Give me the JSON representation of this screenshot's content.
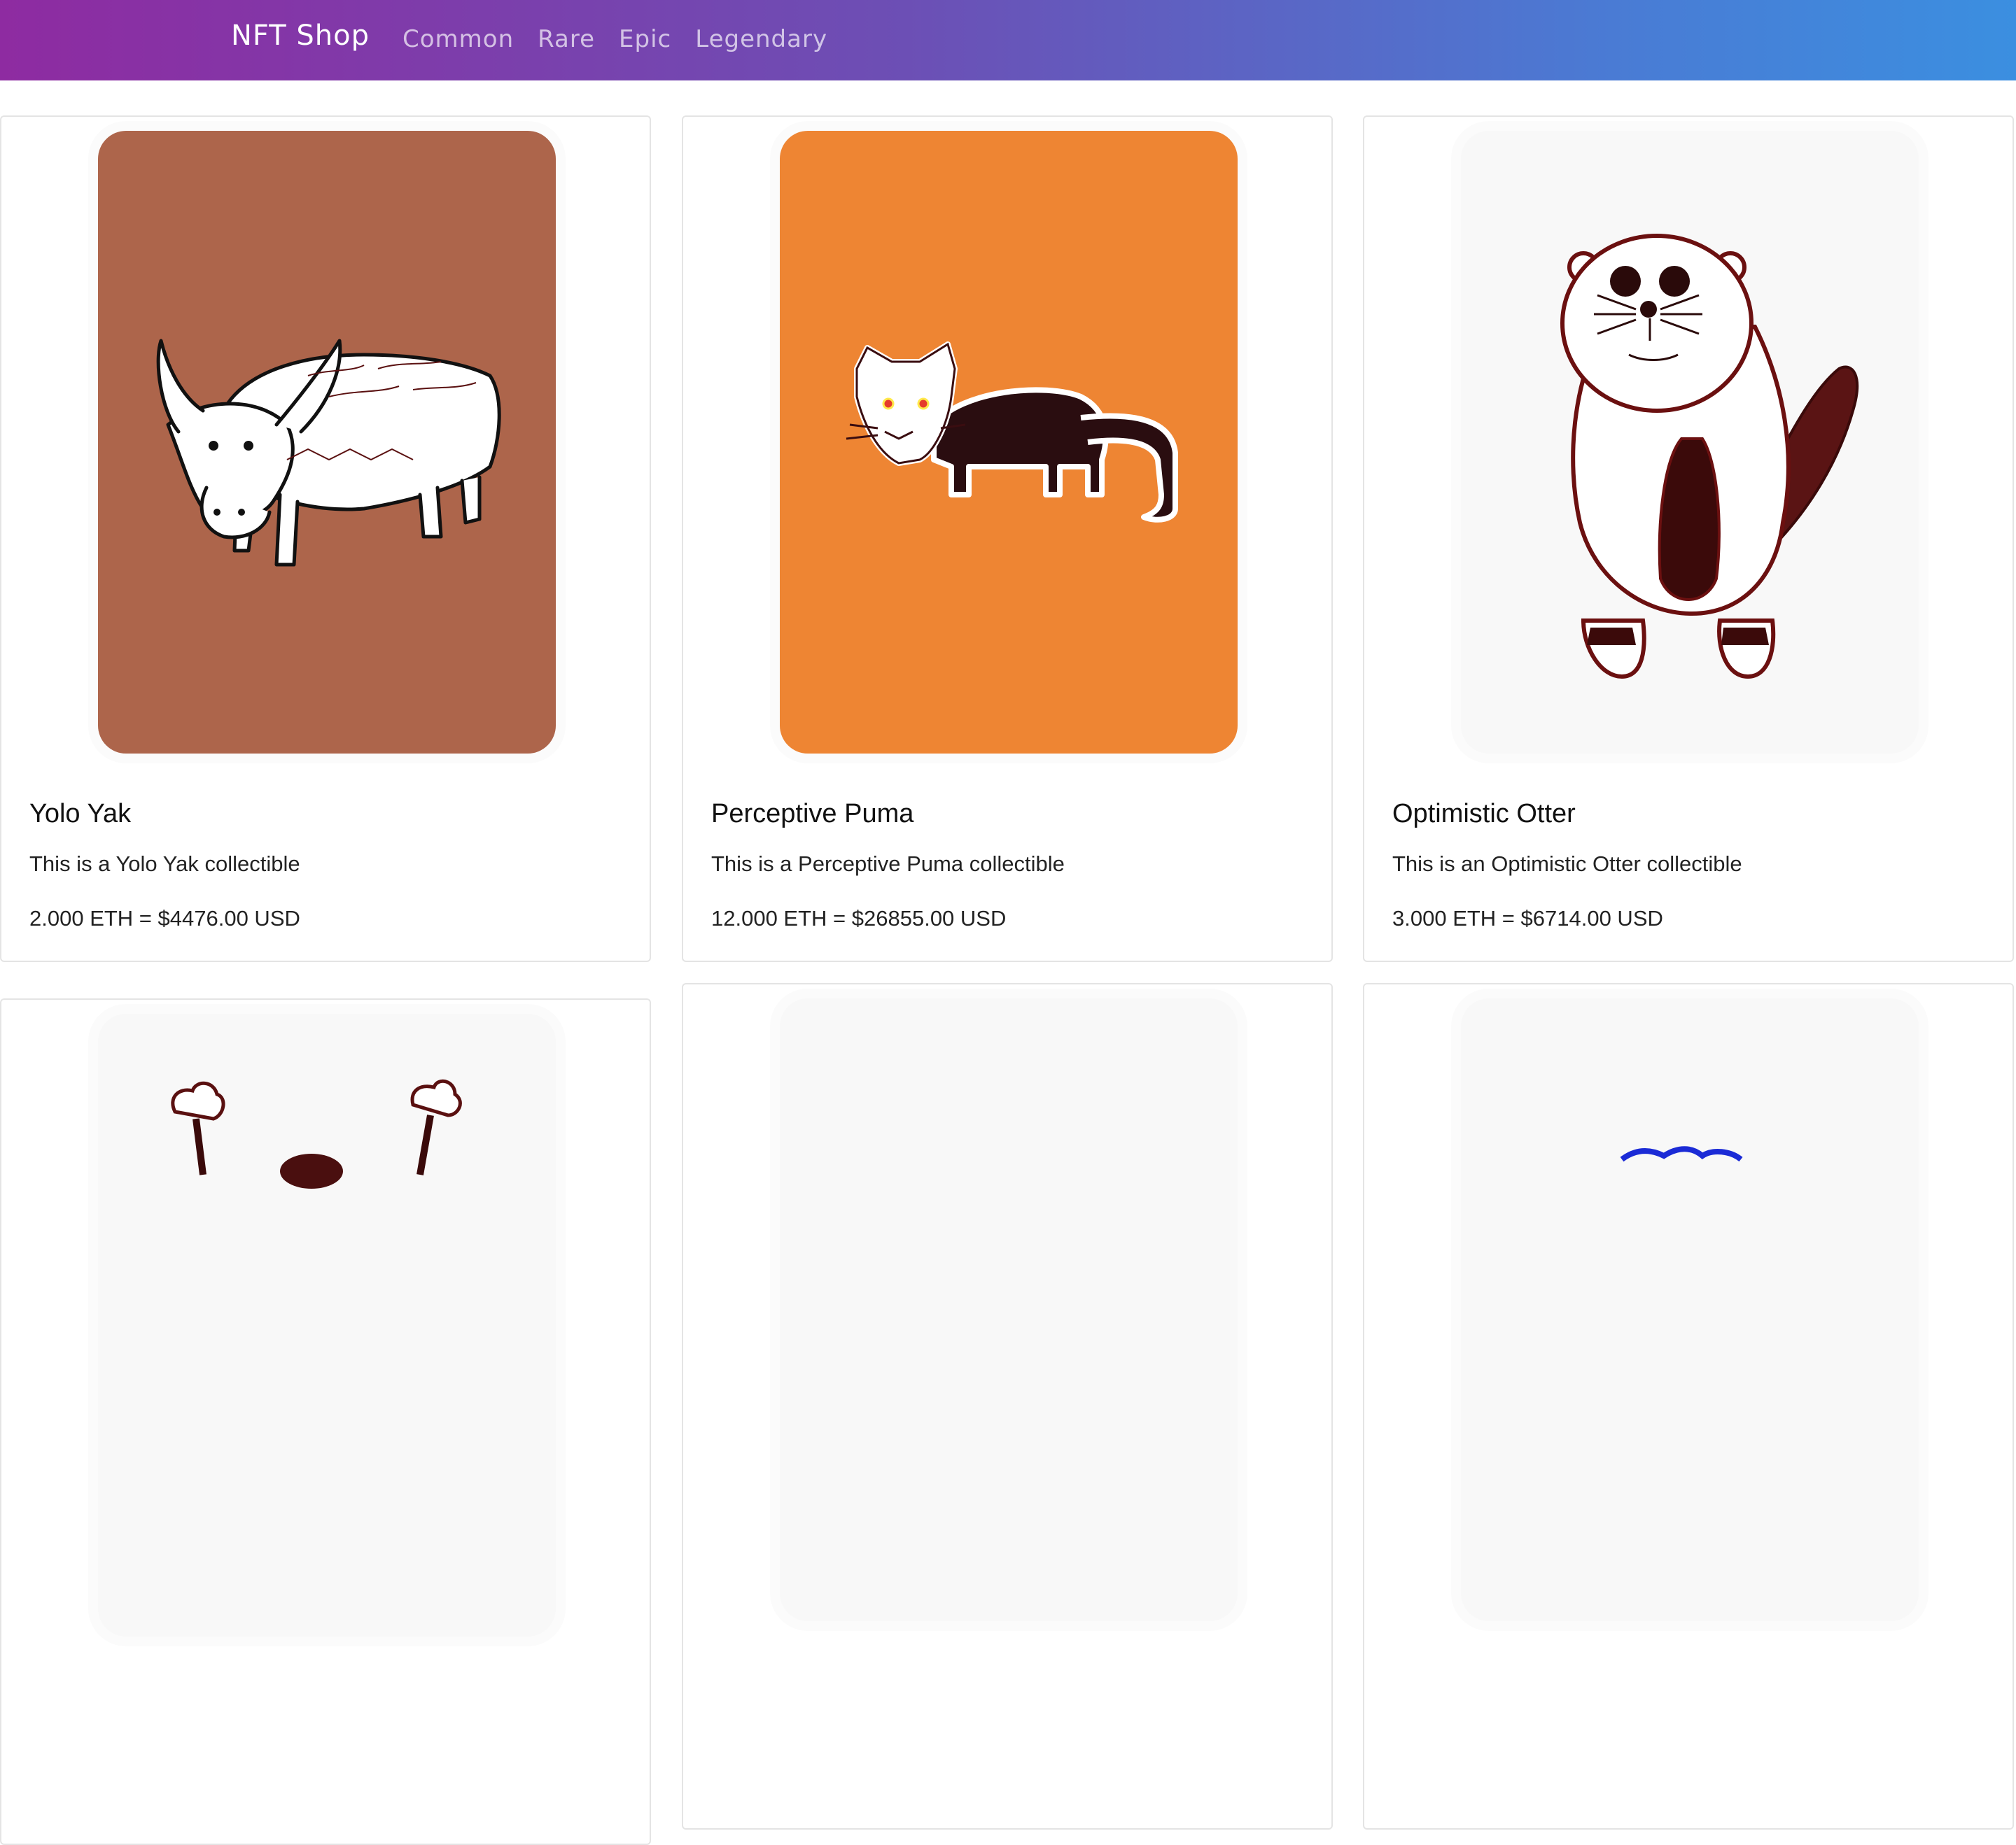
{
  "nav": {
    "brand": "NFT Shop",
    "links": [
      "Common",
      "Rare",
      "Epic",
      "Legendary"
    ]
  },
  "colors": {
    "nav_gradient_start": "#8e2ba1",
    "nav_gradient_end": "#3b8fe0",
    "yak_bg": "#ad654b",
    "puma_bg": "#ee8533",
    "otter_bg": "#f8f8f8"
  },
  "cards": [
    {
      "title": "Yolo Yak",
      "description": "This is a Yolo Yak collectible",
      "price": "2.000 ETH = $4476.00 USD",
      "image": "yak-drawing"
    },
    {
      "title": "Perceptive Puma",
      "description": "This is a Perceptive Puma collectible",
      "price": "12.000 ETH = $26855.00 USD",
      "image": "puma-drawing"
    },
    {
      "title": "Optimistic Otter",
      "description": "This is an Optimistic Otter collectible",
      "price": "3.000 ETH = $6714.00 USD",
      "image": "otter-drawing"
    },
    {
      "image": "raised-arms-drawing"
    },
    {
      "image": "blank-drawing"
    },
    {
      "image": "blue-drawing"
    }
  ]
}
